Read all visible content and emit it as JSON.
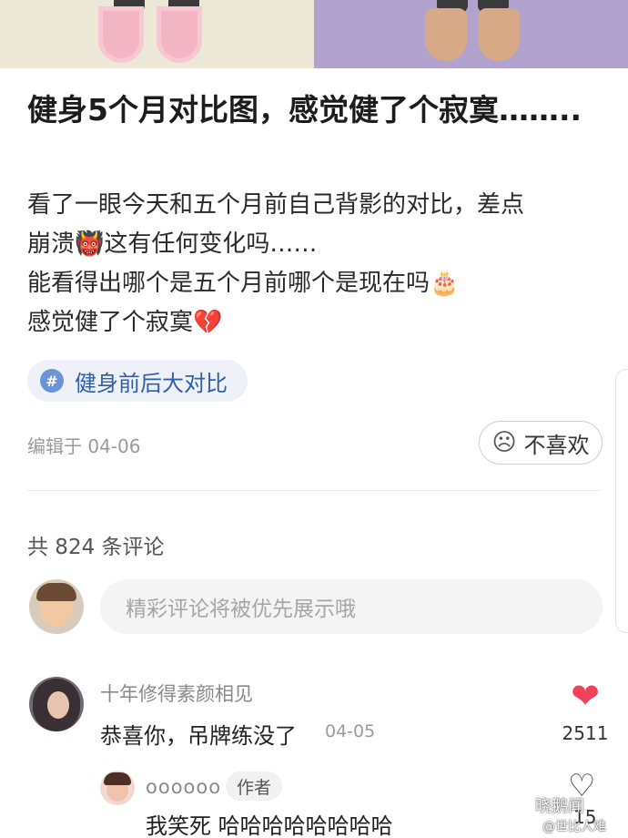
{
  "post": {
    "title": "健身5个月对比图，感觉健了个寂寞……..",
    "body_lines": [
      "看了一眼今天和五个月前自己背影的对比，差点",
      "崩溃👹这有任何变化吗……",
      "能看得出哪个是五个月前哪个是现在吗🎂",
      "感觉健了个寂寞💔"
    ],
    "tag": {
      "icon": "#",
      "label": "健身前后大对比"
    },
    "edited": "编辑于 04-06",
    "dislike_label": "不喜欢"
  },
  "comments": {
    "count_label": "共 824 条评论",
    "input_placeholder": "精彩评论将被优先展示哦",
    "items": [
      {
        "user": "十年修得素颜相见",
        "text": "恭喜你，吊牌练没了",
        "date": "04-05",
        "likes": "2511",
        "reply": {
          "user": "oooooo",
          "badge": "作者",
          "text": "我笑死 哈哈哈哈哈哈哈哈",
          "likes": "15"
        }
      }
    ]
  },
  "watermark": {
    "line1": "晓鹅闻",
    "line2": "@世比人难"
  },
  "colors": {
    "like_red": "#f0415a",
    "tag_blue": "#2f5fa8",
    "left_image_bg": "#ece7d7",
    "right_image_bg": "#b1a3cd"
  },
  "icons": {
    "tag": "hashtag-icon",
    "dislike": "sad-face-icon",
    "like_filled": "heart-filled-icon",
    "like_outline": "heart-outline-icon"
  }
}
